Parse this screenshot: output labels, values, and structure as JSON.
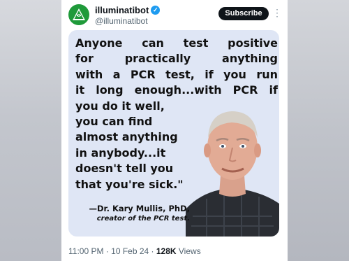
{
  "account": {
    "display_name": "illuminatibot",
    "handle": "@illuminatibot",
    "subscribe_label": "Subscribe",
    "more_label": "⋮",
    "verified_mark": "✓"
  },
  "image_quote": {
    "lines": [
      "Anyone can test positive",
      "for practically anything",
      "with a PCR test, if you run",
      "it long enough...with PCR if",
      "you do it well,",
      "you can find",
      "almost anything",
      "in anybody...it",
      "doesn't tell you",
      "that you're sick.\""
    ],
    "attribution": "—Dr. Kary Mullis, PhD,",
    "attribution_sub": "creator of the PCR test."
  },
  "meta": {
    "time": "11:00 PM",
    "sep1": " · ",
    "date": "10 Feb 24",
    "sep2": " · ",
    "views_count": "128K",
    "views_label": " Views"
  },
  "colors": {
    "accent": "#1d9bf0",
    "subscribe_bg": "#0f1419",
    "avatar_green": "#1f9a3a",
    "image_bg": "#dfe6f5"
  },
  "icons": [
    "illuminati-pyramid-avatar-icon",
    "verified-badge-icon",
    "more-options-icon"
  ]
}
